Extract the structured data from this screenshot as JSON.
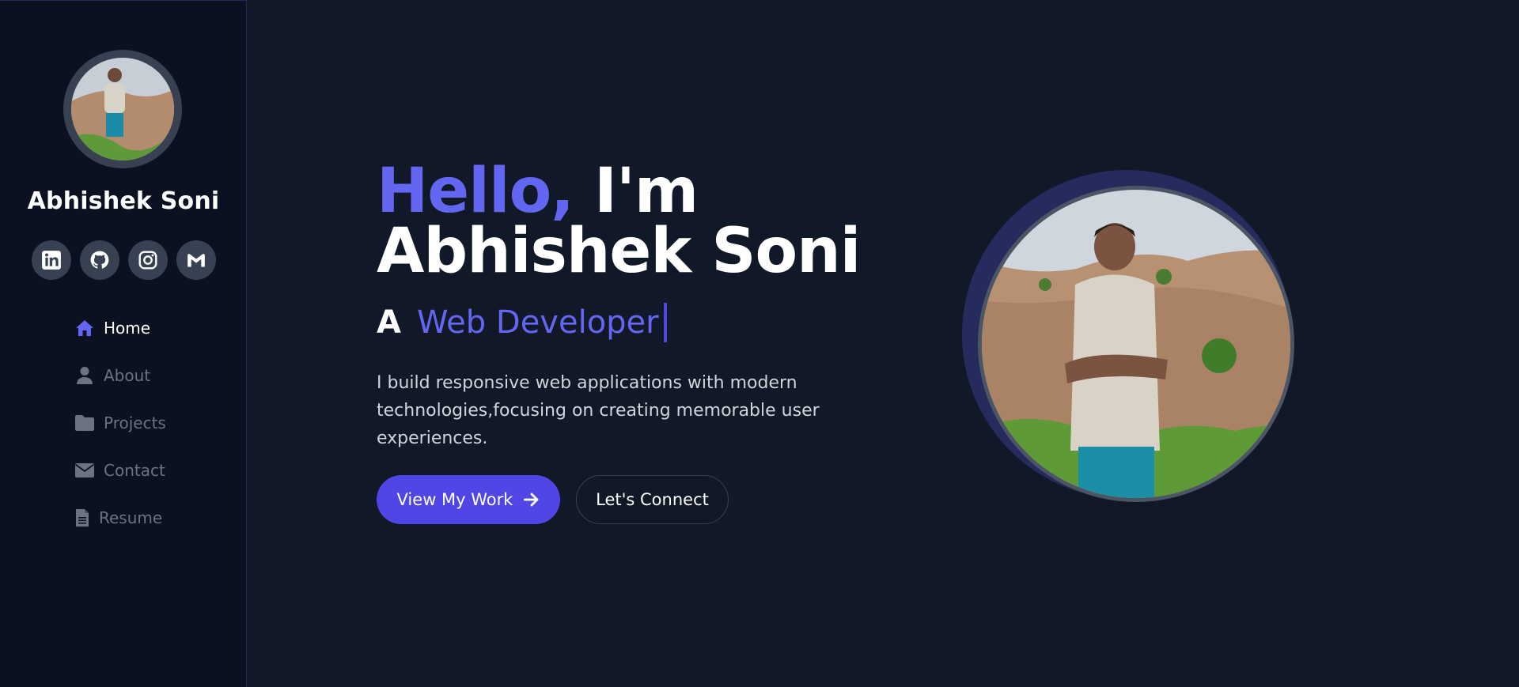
{
  "sidebar": {
    "name": "Abhishek Soni",
    "socials": [
      {
        "icon": "linkedin-icon"
      },
      {
        "icon": "github-icon"
      },
      {
        "icon": "instagram-icon"
      },
      {
        "icon": "gmail-icon"
      }
    ],
    "nav": [
      {
        "label": "Home",
        "icon": "home-icon",
        "active": true
      },
      {
        "label": "About",
        "icon": "user-icon",
        "active": false
      },
      {
        "label": "Projects",
        "icon": "folder-icon",
        "active": false
      },
      {
        "label": "Contact",
        "icon": "envelope-icon",
        "active": false
      },
      {
        "label": "Resume",
        "icon": "document-icon",
        "active": false
      }
    ]
  },
  "hero": {
    "greeting": "Hello,",
    "intro": "I'm",
    "name": "Abhishek Soni",
    "article": "A",
    "role": "Web Developer",
    "description": "I build responsive web applications with modern technologies,focusing on creating memorable user experiences.",
    "primary_button": "View My Work",
    "secondary_button": "Let's Connect"
  },
  "colors": {
    "accent": "#6366f1",
    "button": "#4f46e5",
    "background": "#111827",
    "sidebar": "#0b1120"
  }
}
